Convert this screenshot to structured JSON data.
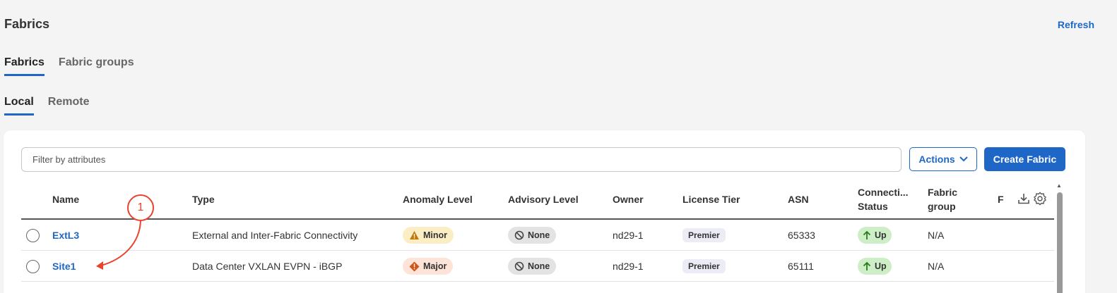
{
  "page": {
    "title": "Fabrics",
    "refresh_label": "Refresh"
  },
  "tabs_primary": [
    {
      "label": "Fabrics",
      "active": true
    },
    {
      "label": "Fabric groups",
      "active": false
    }
  ],
  "tabs_secondary": [
    {
      "label": "Local",
      "active": true
    },
    {
      "label": "Remote",
      "active": false
    }
  ],
  "toolbar": {
    "filter_placeholder": "Filter by attributes",
    "actions_label": "Actions",
    "create_label": "Create Fabric"
  },
  "table": {
    "columns": {
      "name": "Name",
      "type": "Type",
      "anomaly": "Anomaly Level",
      "advisory": "Advisory Level",
      "owner": "Owner",
      "license": "License Tier",
      "asn": "ASN",
      "conn_line1": "Connecti...",
      "conn_line2": "Status",
      "group_line1": "Fabric",
      "group_line2": "group",
      "truncated": "F"
    },
    "rows": [
      {
        "name": "ExtL3",
        "type": "External and Inter-Fabric Connectivity",
        "anomaly": "Minor",
        "advisory": "None",
        "owner": "nd29-1",
        "license": "Premier",
        "asn": "65333",
        "connectivity": "Up",
        "group": "N/A"
      },
      {
        "name": "Site1",
        "type": "Data Center VXLAN EVPN - iBGP",
        "anomaly": "Major",
        "advisory": "None",
        "owner": "nd29-1",
        "license": "Premier",
        "asn": "65111",
        "connectivity": "Up",
        "group": "N/A"
      }
    ]
  },
  "annotation": {
    "number": "1"
  },
  "colors": {
    "accent": "#1e67c7",
    "minor": "#fbeec4",
    "major": "#fde3d8",
    "up": "#cdeec7",
    "annotation": "#e8432b"
  },
  "icons": [
    "download-icon",
    "gear-icon",
    "chevron-down-icon",
    "warning-icon",
    "major-icon",
    "blocked-icon",
    "arrow-up-icon"
  ]
}
